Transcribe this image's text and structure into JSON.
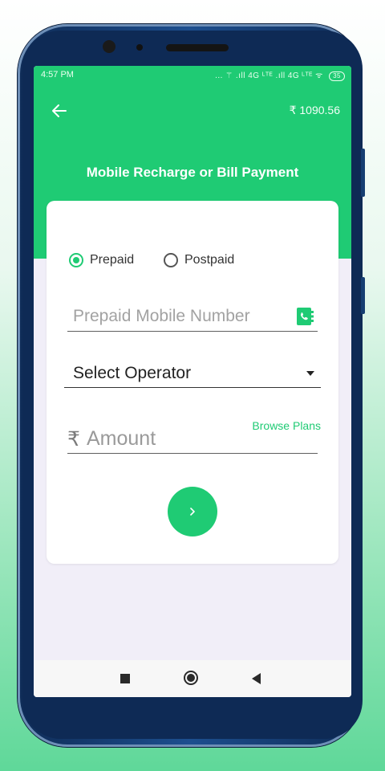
{
  "status_bar": {
    "time": "4:57 PM",
    "network": "... ⚚ .ıll 4G ᴸᵀᴱ .ıll 4G ᴸᵀᴱ",
    "battery": "35"
  },
  "header": {
    "back_icon": "arrow-left-icon",
    "balance": "₹ 1090.56",
    "title": "Mobile Recharge or Bill Payment"
  },
  "form": {
    "plan_type": {
      "options": [
        "Prepaid",
        "Postpaid"
      ],
      "selected": "Prepaid"
    },
    "mobile": {
      "placeholder": "Prepaid Mobile Number",
      "value": "",
      "contact_icon": "contact-book-icon"
    },
    "operator": {
      "selected": "Select Operator"
    },
    "amount": {
      "currency": "₹",
      "placeholder": "Amount",
      "value": "",
      "browse_label": "Browse Plans"
    },
    "submit_icon": "chevron-right-icon"
  },
  "nav": {
    "icons": [
      "recents-square-icon",
      "home-circle-icon",
      "back-triangle-icon"
    ]
  },
  "colors": {
    "accent": "#1fcb74",
    "background": "#f1eef8"
  }
}
